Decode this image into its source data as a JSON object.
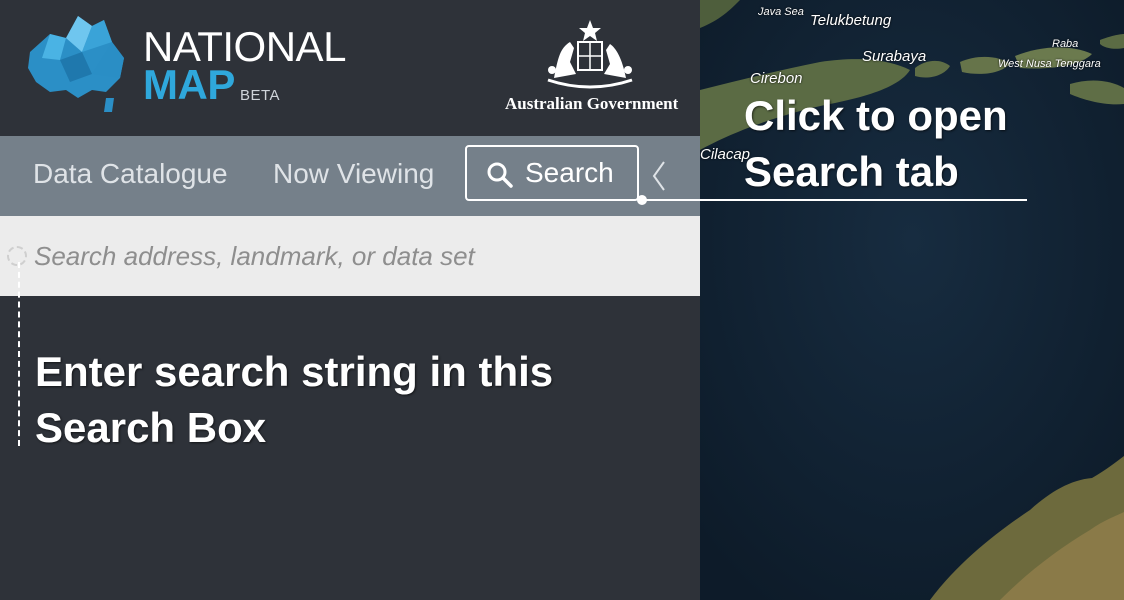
{
  "header": {
    "logo_line1": "NATIONAL",
    "logo_line2": "MAP",
    "logo_badge": "BETA",
    "government": "Australian Government"
  },
  "tabs": {
    "catalogue": "Data Catalogue",
    "viewing": "Now Viewing",
    "search": "Search"
  },
  "search": {
    "placeholder": "Search address, landmark, or data set"
  },
  "annotations": {
    "search_tab": "Click to open Search tab",
    "search_box": "Enter search string in this Search Box"
  },
  "map": {
    "labels": [
      "Java Sea",
      "Surabaya",
      "Cirebon",
      "Cilacap",
      "West Nusa Tenggara",
      "Raba",
      "Telukbetung"
    ]
  },
  "colors": {
    "panel": "#2e3239",
    "tabbar": "#75808a",
    "searchbar": "#ececec",
    "brand_blue": "#2fa8dc"
  }
}
